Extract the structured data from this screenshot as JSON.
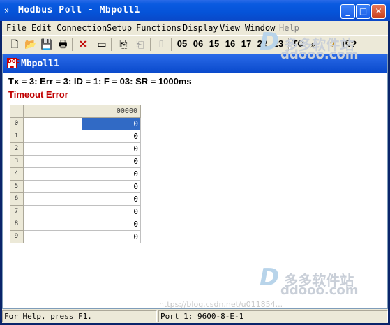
{
  "window": {
    "title": "Modbus Poll - Mbpoll1",
    "app_icon": "modbus-poll-icon",
    "controls": [
      "minimize",
      "maximize",
      "close"
    ]
  },
  "menu": [
    "File",
    "Edit",
    "Connection",
    "Setup",
    "Functions",
    "Display",
    "View",
    "Window",
    "Help"
  ],
  "toolbar": {
    "icons": [
      "new-file-icon",
      "open-folder-icon",
      "save-icon",
      "print-icon",
      "delete-icon",
      "window-icon",
      "connect-icon",
      "disconnect-icon",
      "pulse-icon"
    ],
    "function_codes": [
      "05",
      "06",
      "15",
      "16",
      "17",
      "22",
      "23"
    ],
    "tc_label": "TC",
    "extra_icons": [
      "find-icon",
      "help-icon",
      "context-help-icon"
    ]
  },
  "child_window": {
    "title": "Mbpoll1",
    "status_line": "Tx = 3: Err = 3: ID = 1: F = 03: SR = 1000ms",
    "error_text": "Timeout Error",
    "columns": [
      "",
      "00000"
    ],
    "rows": [
      {
        "label": "0",
        "name": "",
        "value": "0"
      },
      {
        "label": "1",
        "name": "",
        "value": "0"
      },
      {
        "label": "2",
        "name": "",
        "value": "0"
      },
      {
        "label": "3",
        "name": "",
        "value": "0"
      },
      {
        "label": "4",
        "name": "",
        "value": "0"
      },
      {
        "label": "5",
        "name": "",
        "value": "0"
      },
      {
        "label": "6",
        "name": "",
        "value": "0"
      },
      {
        "label": "7",
        "name": "",
        "value": "0"
      },
      {
        "label": "8",
        "name": "",
        "value": "0"
      },
      {
        "label": "9",
        "name": "",
        "value": "0"
      }
    ],
    "selected_row": 0
  },
  "statusbar": {
    "help": "For Help, press F1.",
    "port": "Port 1: 9600-8-E-1"
  },
  "watermark": {
    "logo_letter": "D",
    "cn_text": "多多软件站",
    "site": "ddooo.com",
    "blog_url": "https://blog.csdn.net/u011854..."
  },
  "colors": {
    "titlebar": "#0A5AE0",
    "selection": "#316AC5",
    "error": "#C00000"
  }
}
